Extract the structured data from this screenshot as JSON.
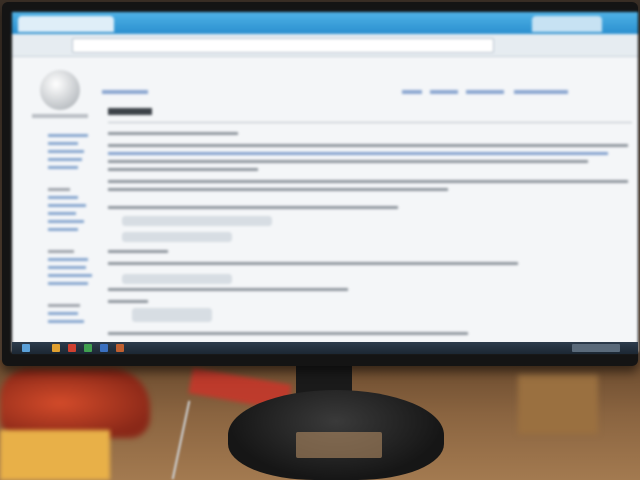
{
  "scene": {
    "description_type": "photo",
    "objects": [
      "monitor",
      "browser-window",
      "desk",
      "monitor-stand",
      "red-object",
      "paper",
      "cable"
    ]
  },
  "screen": {
    "content_readable": false,
    "page_kind": "encyclopedia-article",
    "colors": {
      "browser_titlebar": "#2a8fcf",
      "page_background": "#f4f6f8",
      "link_color": "#5f86c0",
      "taskbar": "#1c2733"
    }
  }
}
